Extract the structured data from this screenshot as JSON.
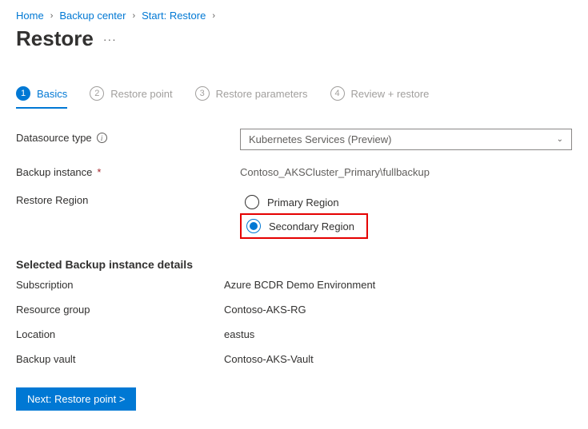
{
  "breadcrumb": {
    "items": [
      {
        "label": "Home"
      },
      {
        "label": "Backup center"
      },
      {
        "label": "Start: Restore"
      }
    ]
  },
  "page": {
    "title": "Restore",
    "ellipsis": "···"
  },
  "tabs": [
    {
      "num": "1",
      "label": "Basics"
    },
    {
      "num": "2",
      "label": "Restore point"
    },
    {
      "num": "3",
      "label": "Restore parameters"
    },
    {
      "num": "4",
      "label": "Review + restore"
    }
  ],
  "form": {
    "datasourceTypeLabel": "Datasource type",
    "datasourceTypeValue": "Kubernetes Services (Preview)",
    "backupInstanceLabel": "Backup instance",
    "backupInstanceRequired": "*",
    "backupInstanceValue": "Contoso_AKSCluster_Primary\\fullbackup",
    "restoreRegionLabel": "Restore Region",
    "radio": {
      "primary": "Primary Region",
      "secondary": "Secondary Region",
      "selected": "secondary"
    }
  },
  "details": {
    "heading": "Selected Backup instance details",
    "rows": [
      {
        "label": "Subscription",
        "value": "Azure BCDR Demo Environment"
      },
      {
        "label": "Resource group",
        "value": "Contoso-AKS-RG"
      },
      {
        "label": "Location",
        "value": "eastus"
      },
      {
        "label": "Backup vault",
        "value": "Contoso-AKS-Vault"
      }
    ]
  },
  "footer": {
    "nextLabel": "Next: Restore point  >"
  }
}
